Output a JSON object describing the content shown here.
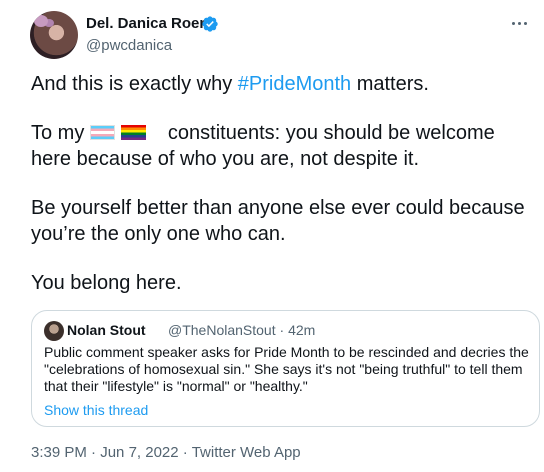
{
  "author": {
    "name": "Del. Danica Roem",
    "handle": "@pwcdanica"
  },
  "tweet": {
    "line1_before": "And this is exactly why ",
    "hashtag": "#PrideMonth",
    "line1_after": " matters.",
    "para2_prefix": "To my ",
    "para2_rest": "constituents: you should be welcome here because of who you are, not despite it.",
    "para3": "Be yourself better than anyone else ever could because you’re the only one who can.",
    "para4": "You belong here."
  },
  "quote": {
    "name": "Nolan Stout",
    "handle": "@TheNolanStout",
    "separator": "·",
    "time": "42m",
    "text": "Public comment speaker asks for Pride Month to be rescinded and decries the \"celebrations of homosexual sin.\" She says it's not \"being truthful\" to tell them that their \"lifestyle\" is \"normal\" or \"healthy.\"",
    "link": "Show this thread"
  },
  "meta": {
    "time": "3:39 PM",
    "sep1": " · ",
    "date": "Jun 7, 2022",
    "sep2": " · ",
    "source": "Twitter Web App"
  },
  "colors": {
    "link": "#1d9bf0",
    "secondary_text": "#536471",
    "border": "#cfd9de"
  },
  "icons": {
    "verified": "verified-badge-icon",
    "more": "more-options-icon",
    "trans_flag": "transgender-flag-emoji",
    "rainbow_flag": "rainbow-flag-emoji"
  }
}
